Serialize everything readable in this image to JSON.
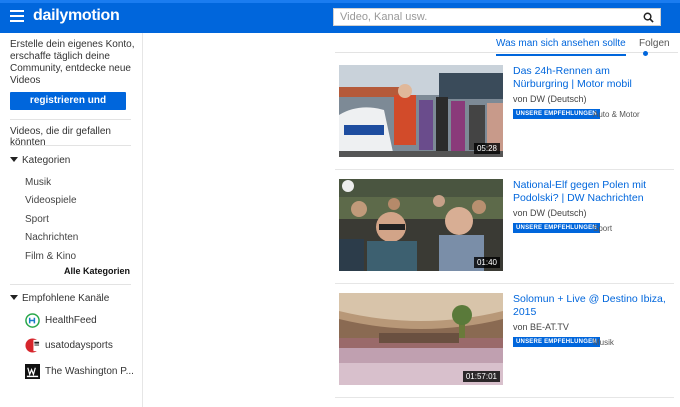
{
  "header": {
    "logo": "dailymotion",
    "search_placeholder": "Video, Kanal usw."
  },
  "sidebar": {
    "intro": "Erstelle dein eigenes Konto, erschaffe täglich deine Community, entdecke neue Videos",
    "signup_label": "registrieren und anmelden",
    "liked_label": "Videos, die dir gefallen könnten",
    "categories_title": "Kategorien",
    "categories": [
      "Musik",
      "Videospiele",
      "Sport",
      "Nachrichten",
      "Film & Kino"
    ],
    "all_categories": "Alle Kategorien",
    "channels_title": "Empfohlene Kanäle",
    "channels": [
      "HealthFeed",
      "usatodaysports",
      "The Washington P..."
    ]
  },
  "tabs": {
    "active": "Was man sich ansehen sollte",
    "follow": "Folgen"
  },
  "videos": [
    {
      "title": "Das 24h-Rennen am Nürburgring | Motor mobil",
      "channel": "von DW (Deutsch)",
      "badge": "UNSERE EMPFEHLUNGEN",
      "category": "Auto & Motor",
      "duration": "05:28"
    },
    {
      "title": "National-Elf gegen Polen mit Podolski? | DW Nachrichten",
      "channel": "von DW (Deutsch)",
      "badge": "UNSERE EMPFEHLUNGEN",
      "category": "Sport",
      "duration": "01:40"
    },
    {
      "title": "Solomun + Live @ Destino Ibiza, 2015",
      "channel": "von BE-AT.TV",
      "badge": "UNSERE EMPFEHLUNGEN",
      "category": "Musik",
      "duration": "01:57:01"
    }
  ],
  "colors": {
    "brand": "#0066dc"
  }
}
